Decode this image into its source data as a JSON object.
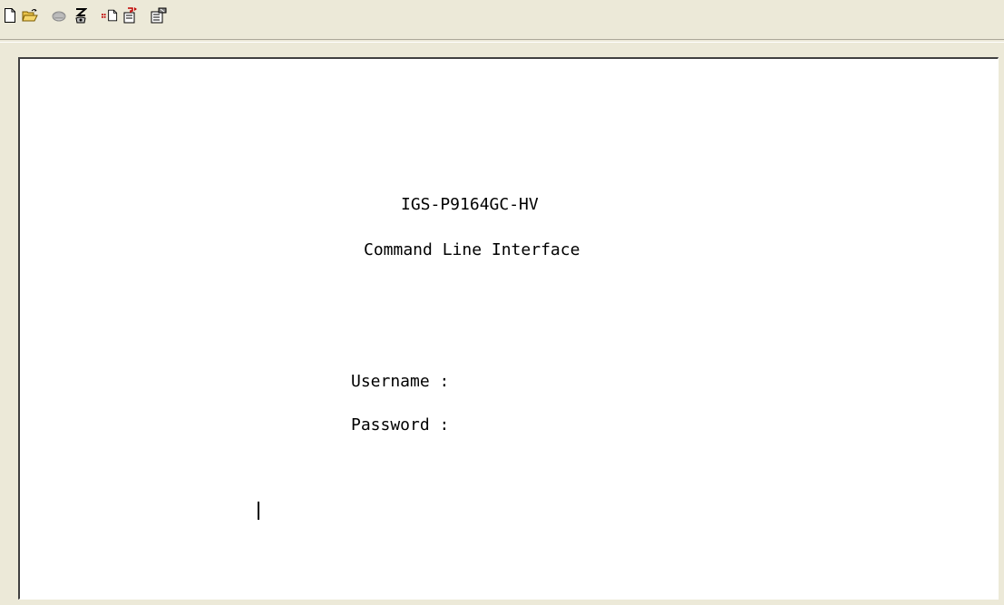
{
  "toolbar": {
    "buttons": [
      {
        "name": "new-icon"
      },
      {
        "name": "open-icon"
      },
      {
        "name": "disconnect-icon"
      },
      {
        "name": "connect-icon"
      },
      {
        "name": "send-icon"
      },
      {
        "name": "receive-icon"
      },
      {
        "name": "properties-icon"
      }
    ]
  },
  "terminal": {
    "device_name": "IGS-P9164GC-HV",
    "subtitle": "Command Line Interface",
    "username_label": "Username :",
    "password_label": "Password :"
  }
}
